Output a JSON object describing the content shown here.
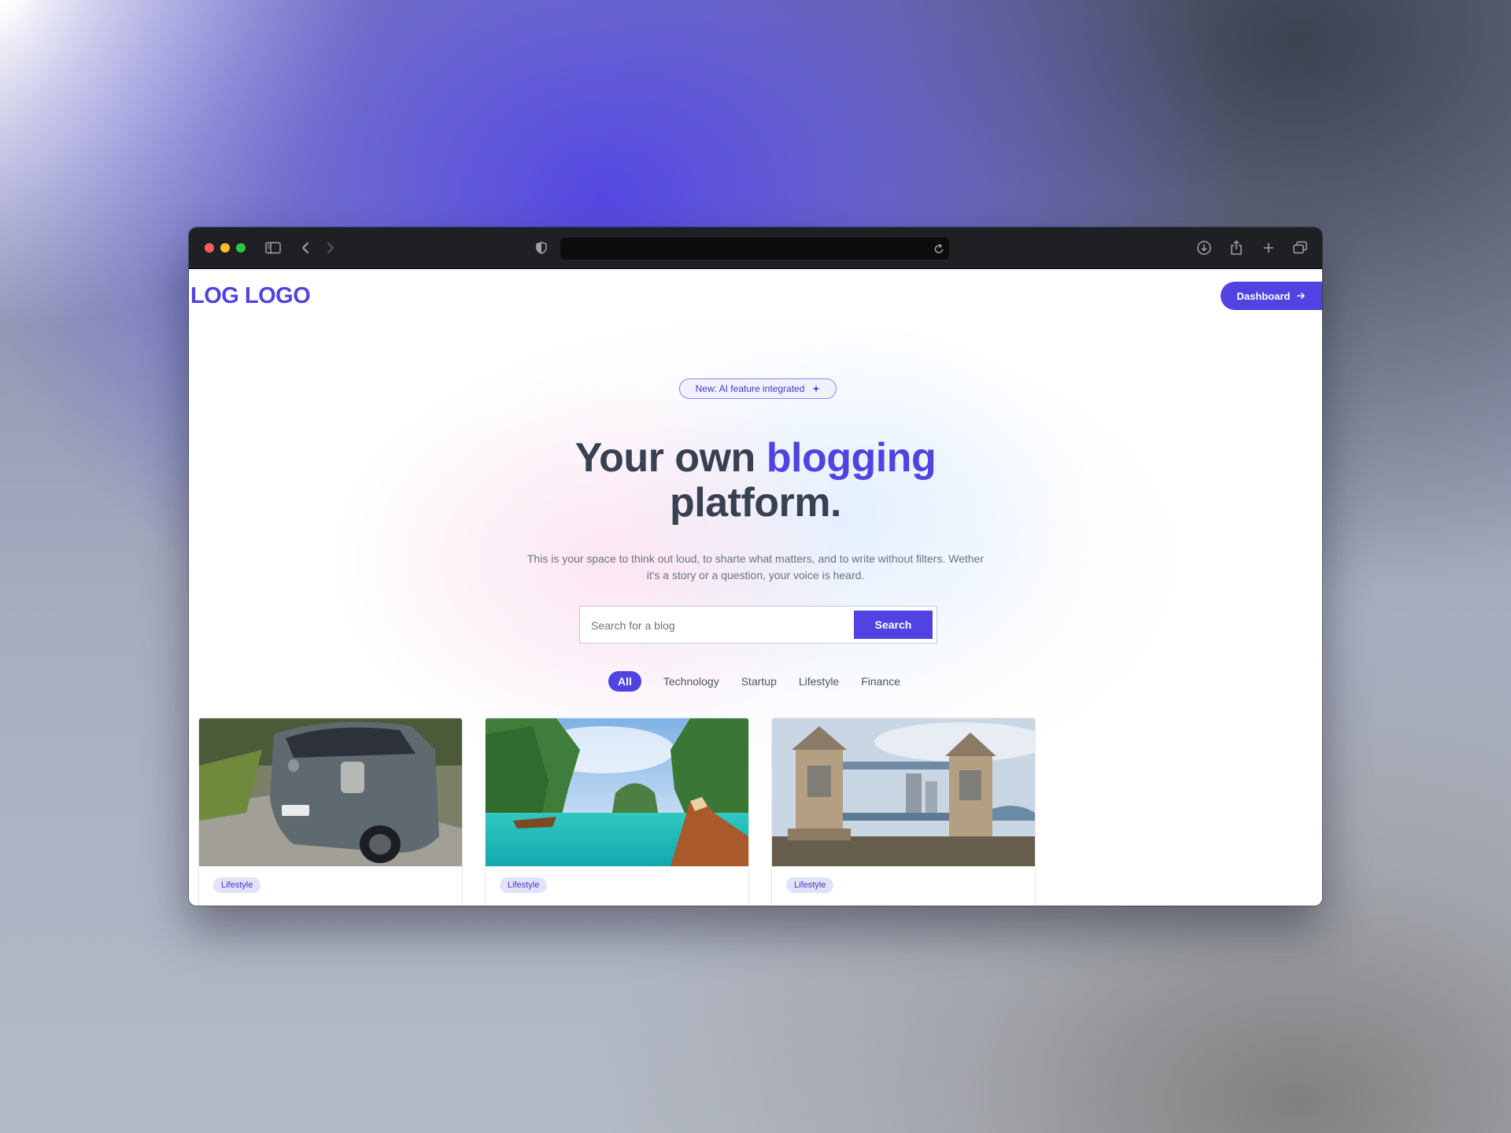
{
  "browser": {
    "url": "",
    "controls": [
      "sidebar-toggle-icon",
      "back-icon",
      "forward-icon",
      "shield-icon",
      "reload-icon",
      "download-icon",
      "share-icon",
      "new-tab-icon",
      "tab-overview-icon"
    ]
  },
  "header": {
    "logo": "LOG LOGO",
    "dashboard_label": "Dashboard"
  },
  "hero": {
    "badge_text": "New: AI feature integrated",
    "headline_pre": "Your own ",
    "headline_accent": "blogging",
    "headline_post": "platform.",
    "subtitle": "This is your space to think out loud, to sharte what matters, and to write without filters. Wether it's a story or a question, your voice is heard."
  },
  "search": {
    "placeholder": "Search for a blog",
    "value": "",
    "button_label": "Search"
  },
  "filters": [
    {
      "label": "All",
      "active": true
    },
    {
      "label": "Technology",
      "active": false
    },
    {
      "label": "Startup",
      "active": false
    },
    {
      "label": "Lifestyle",
      "active": false
    },
    {
      "label": "Finance",
      "active": false
    }
  ],
  "cards": [
    {
      "image": "damaged-car-photo",
      "tag": "Lifestyle"
    },
    {
      "image": "tropical-boat-photo",
      "tag": "Lifestyle"
    },
    {
      "image": "tower-bridge-photo",
      "tag": "Lifestyle"
    }
  ],
  "colors": {
    "accent": "#5043e1",
    "titlebar": "#1f2024",
    "heading": "#374151"
  }
}
